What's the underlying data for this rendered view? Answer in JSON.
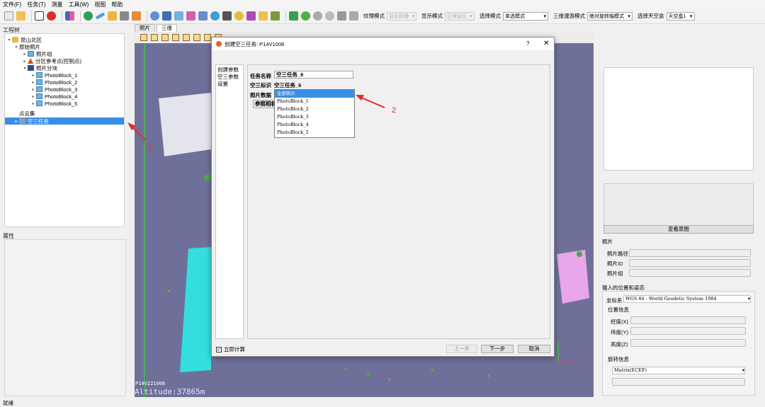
{
  "menubar": [
    "文件(F)",
    "任务(T)",
    "测量",
    "工具(W)",
    "视图",
    "帮助"
  ],
  "toolbar": {
    "texture_mode_label": "纹理模式",
    "texture_mode_value": "显示纹理",
    "display_mode_label": "显示模式",
    "display_mode_value": "正常显示",
    "select_mode_label": "选择模式",
    "select_mode_value": "单选模式",
    "roam_mode_label": "三维漫游模式",
    "roam_mode_value": "绝对旋转轴模式",
    "sky_label": "选择天空盒",
    "sky_value": "天空盒1"
  },
  "project_tree": {
    "title": "工程树",
    "items": [
      {
        "label": "昆山北区",
        "level": 0,
        "arrow": "▾"
      },
      {
        "label": "原始照片",
        "level": 1,
        "arrow": "▾"
      },
      {
        "label": "照片组",
        "level": 2,
        "arrow": "▸"
      },
      {
        "label": "分区参考点(控制点)",
        "level": 2,
        "arrow": "▸"
      },
      {
        "label": "照片分块",
        "level": 2,
        "arrow": "▾"
      },
      {
        "label": "PhotoBlock_1",
        "level": 3,
        "arrow": "▸"
      },
      {
        "label": "PhotoBlock_2",
        "level": 3,
        "arrow": "▸"
      },
      {
        "label": "PhotoBlock_3",
        "level": 3,
        "arrow": "▸"
      },
      {
        "label": "PhotoBlock_4",
        "level": 3,
        "arrow": "▸"
      },
      {
        "label": "PhotoBlock_5",
        "level": 3,
        "arrow": "▸"
      },
      {
        "label": "点云集",
        "level": 1,
        "arrow": ""
      },
      {
        "label": "空三任务",
        "level": 1,
        "arrow": "▸"
      }
    ]
  },
  "properties": {
    "title": "属性"
  },
  "view_tabs": [
    "照片",
    "三维"
  ],
  "viewport": {
    "altitude": "Altitude:37865m",
    "photo_id": "P14V221008"
  },
  "right_panel": {
    "view_original_button": "查看原图",
    "photo_section": "照片",
    "photo_path": "照片路径",
    "photo_id": "照片ID",
    "photo_group": "照片组",
    "pose_section": "输入的位置和姿态",
    "crs_label": "坐标系",
    "crs_value": "WGS 84 - World Geodetic System 1984",
    "position_section": "位置信息",
    "lon": "经度(X)",
    "lat": "纬度(Y)",
    "alt": "高度(Z)",
    "rotation_section": "旋转信息",
    "rotation_value": "Matrix(ECEF)"
  },
  "dialog": {
    "title": "创建空三任务: P14V1008",
    "help": "?",
    "close": "✕",
    "nav": [
      "创建参数",
      "空三参数",
      "设置"
    ],
    "task_name_label": "任务名称",
    "task_name_value": "空三任务_6",
    "aerial_id_label": "空三标识",
    "aerial_id_value": "空三任务_6",
    "photo_data_label": "照片数据",
    "ref_button": "参照相机",
    "dropdown_options": [
      "全部照片",
      "PhotoBlock_1",
      "PhotoBlock_2",
      "PhotoBlock_3",
      "PhotoBlock_4",
      "PhotoBlock_5"
    ],
    "compute_now": "立即计算",
    "prev_button": "上一步",
    "next_button": "下一步",
    "cancel_button": "取消"
  },
  "annotations": {
    "one": "1",
    "two": "2"
  },
  "status_bar": "就绪",
  "colors": {
    "selection": "#3a8ee6",
    "viewport_bg": "#6f709a",
    "annotation": "#e32a2a"
  }
}
